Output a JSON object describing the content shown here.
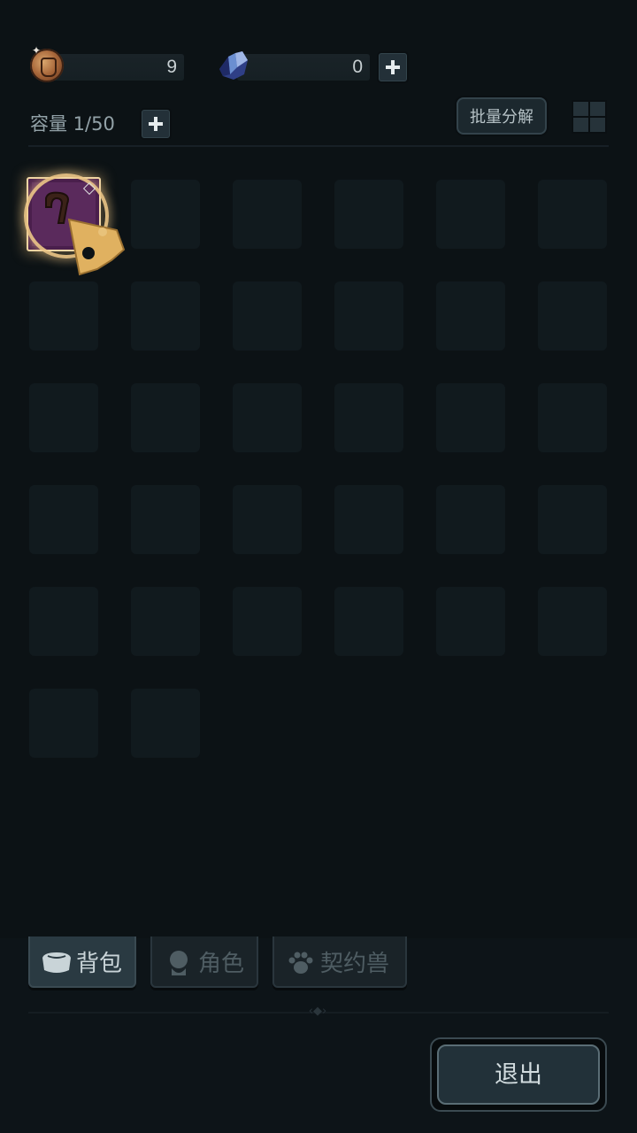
{
  "currency": {
    "coin_value": "9",
    "crystal_value": "0",
    "coin_icon": "bronze-coin-icon",
    "crystal_icon": "blue-crystal-icon"
  },
  "inventory": {
    "capacity_label": "容量 1/50",
    "batch_button": "批量分解",
    "total_slots_shown": 32,
    "items": [
      {
        "icon": "staff-icon",
        "rarity_color": "#4a1f4c"
      }
    ]
  },
  "tabs": [
    {
      "label": "背包",
      "icon": "bag-icon",
      "active": true
    },
    {
      "label": "角色",
      "icon": "character-icon",
      "active": false
    },
    {
      "label": "契约兽",
      "icon": "paw-icon",
      "active": false
    }
  ],
  "exit_button": "退出",
  "colors": {
    "accent_gold": "#f0d6a5",
    "item_purple": "#4a1f4c",
    "background": "#0c1216"
  }
}
